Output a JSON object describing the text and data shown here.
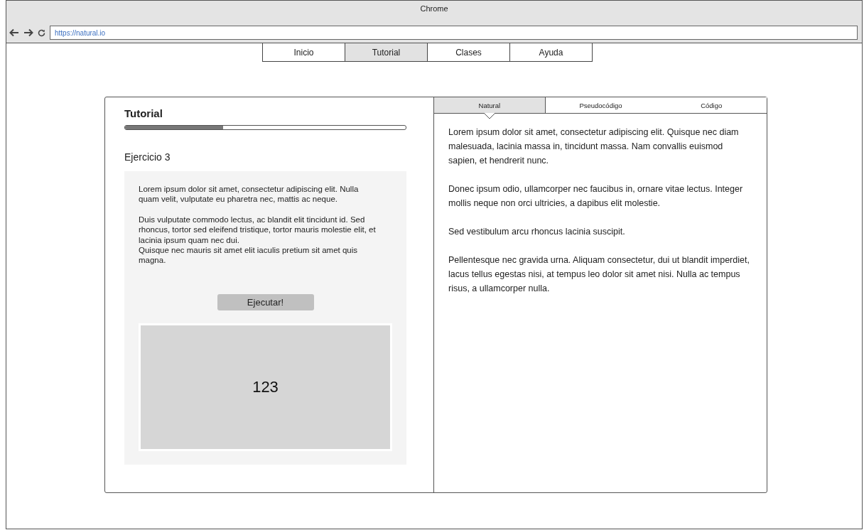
{
  "window": {
    "title": "Chrome"
  },
  "address_bar": {
    "url": "https://natural.io"
  },
  "nav": [
    {
      "label": "Inicio",
      "selected": false
    },
    {
      "label": "Tutorial",
      "selected": true
    },
    {
      "label": "Clases",
      "selected": false
    },
    {
      "label": "Ayuda",
      "selected": false
    }
  ],
  "tutorial": {
    "title": "Tutorial",
    "progress": {
      "level": 0.35
    },
    "exercise_title": "Ejercicio 3",
    "paragraphs": [
      "Lorem ipsum dolor sit amet, consectetur adipiscing elit. Nulla quam velit, vulputate eu pharetra nec, mattis ac neque.",
      "Duis vulputate commodo lectus, ac blandit elit tincidunt id. Sed rhoncus, tortor sed eleifend tristique, tortor mauris molestie elit, et lacinia ipsum quam nec dui.\nQuisque nec mauris sit amet elit iaculis pretium sit amet quis magna."
    ],
    "run_button": "Ejecutar!",
    "output": "123"
  },
  "explanation": {
    "tabs": [
      {
        "label": "Natural",
        "selected": true
      },
      {
        "label": "Pseudocódigo",
        "selected": false
      },
      {
        "label": "Código",
        "selected": false
      }
    ],
    "paragraphs": [
      "Lorem ipsum dolor sit amet, consectetur adipiscing elit. Quisque nec diam malesuada, lacinia massa in, tincidunt massa. Nam convallis euismod sapien, et hendrerit nunc.",
      "Donec ipsum odio, ullamcorper nec faucibus in, ornare vitae lectus. Integer mollis neque non orci ultricies, a dapibus elit molestie.",
      "Sed vestibulum arcu rhoncus lacinia suscipit.",
      "Pellentesque nec gravida urna. Aliquam consectetur, dui ut blandit imperdiet, lacus tellus egestas nisi, at tempus leo dolor sit amet nisi. Nulla ac tempus risus, a ullamcorper nulla."
    ]
  }
}
